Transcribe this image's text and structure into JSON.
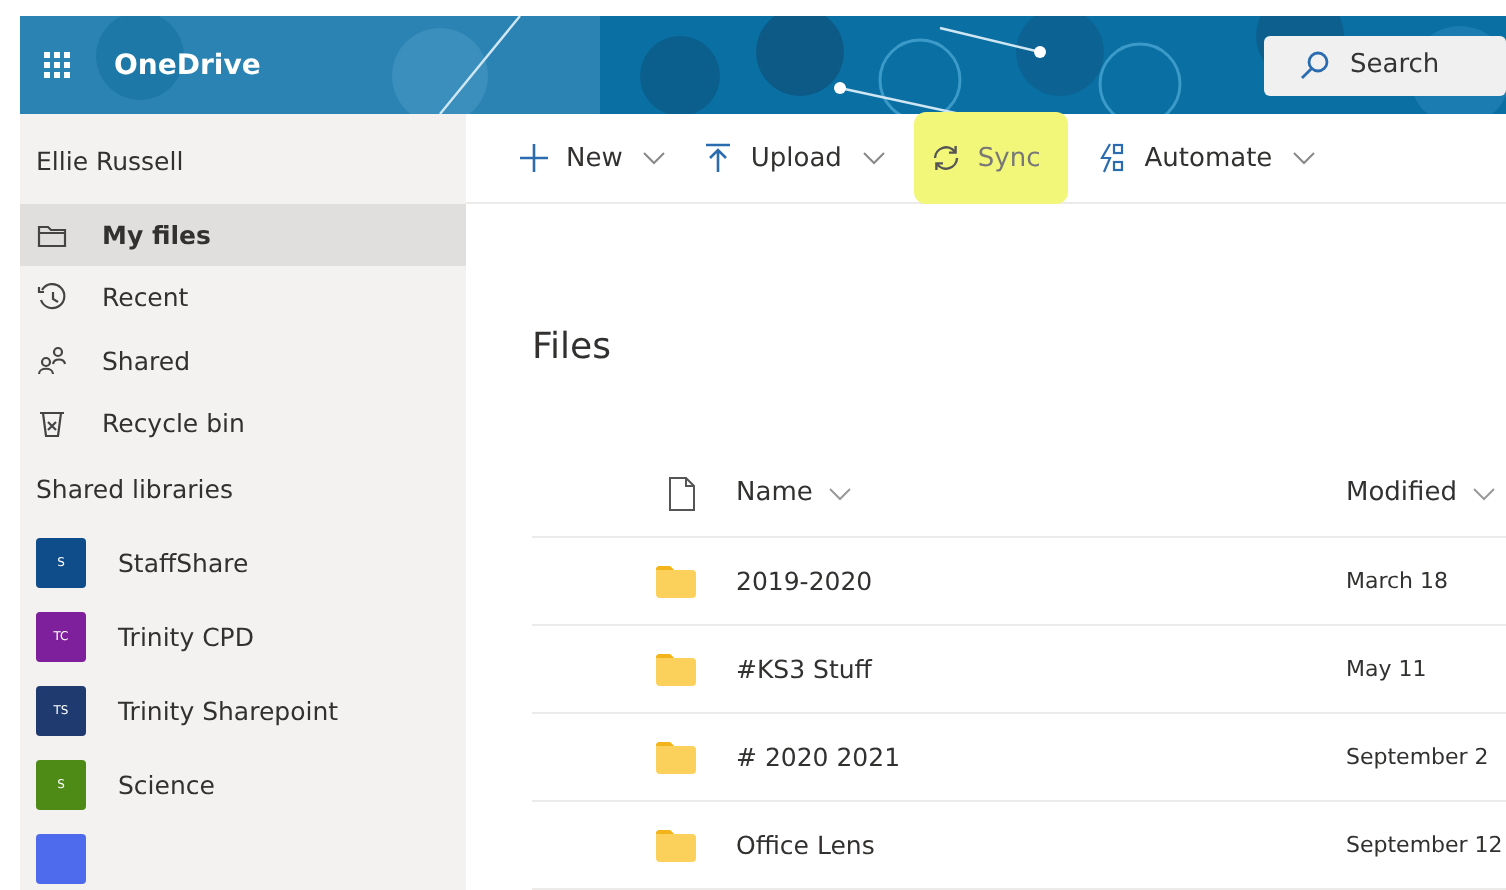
{
  "app": {
    "name": "OneDrive"
  },
  "search": {
    "placeholder": "Search"
  },
  "user": {
    "name": "Ellie Russell"
  },
  "toolbar": [
    {
      "kind": "plus",
      "label": "New",
      "dropdown": true,
      "highlighted": false
    },
    {
      "kind": "upload",
      "label": "Upload",
      "dropdown": true,
      "highlighted": false
    },
    {
      "kind": "sync",
      "label": "Sync",
      "dropdown": false,
      "highlighted": true
    },
    {
      "kind": "automate",
      "label": "Automate",
      "dropdown": true,
      "highlighted": false
    }
  ],
  "nav": [
    {
      "kind": "folder",
      "label": "My files",
      "selected": true
    },
    {
      "kind": "recent",
      "label": "Recent",
      "selected": false
    },
    {
      "kind": "shared",
      "label": "Shared",
      "selected": false
    },
    {
      "kind": "bin",
      "label": "Recycle bin",
      "selected": false
    }
  ],
  "libraries_heading": "Shared libraries",
  "libraries": [
    {
      "initials": "S",
      "label": "StaffShare",
      "color": "#0f4c8a"
    },
    {
      "initials": "TC",
      "label": "Trinity CPD",
      "color": "#7e1f9c"
    },
    {
      "initials": "TS",
      "label": "Trinity Sharepoint",
      "color": "#1f3a6e"
    },
    {
      "initials": "S",
      "label": "Science",
      "color": "#4d8a16"
    },
    {
      "color": "#4f6bed"
    }
  ],
  "page_title": "Files",
  "table": {
    "columns": [
      "Name",
      "Modified"
    ],
    "rows": [
      {
        "name": "2019-2020",
        "modified": "March 18"
      },
      {
        "name": "#KS3 Stuff",
        "modified": "May 11"
      },
      {
        "name": "# 2020 2021",
        "modified": "September 2"
      },
      {
        "name": "Office Lens",
        "modified": "September 12"
      }
    ]
  }
}
